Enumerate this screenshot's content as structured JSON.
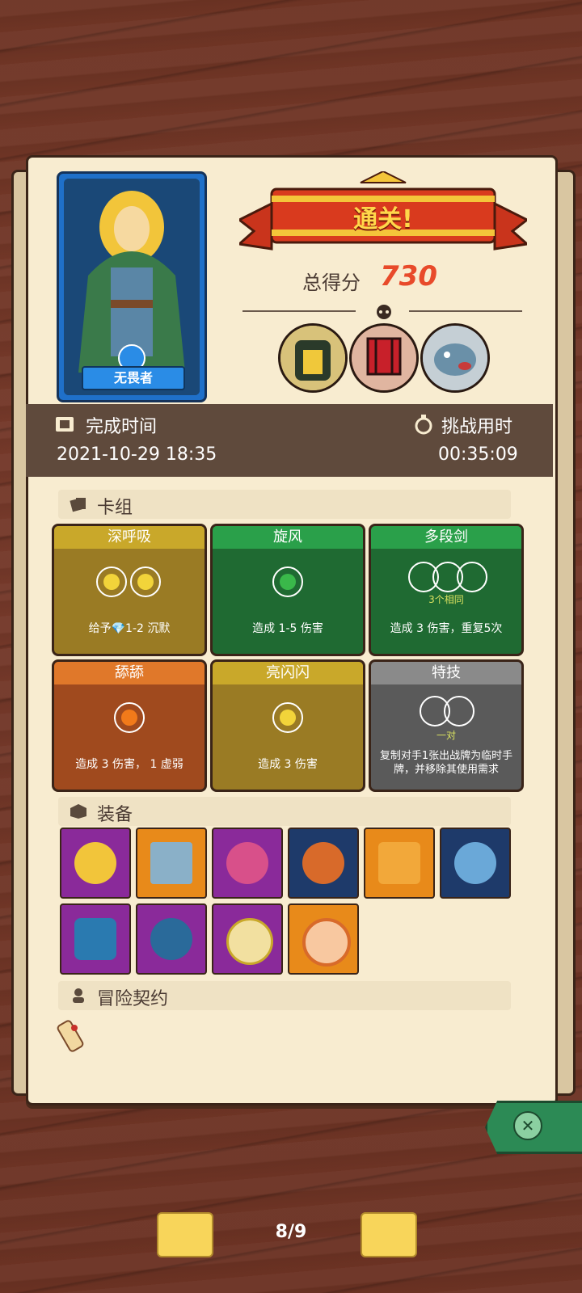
{
  "hero": {
    "name": "无畏者"
  },
  "result": {
    "banner": "通关!",
    "score_label": "总得分",
    "score": "730"
  },
  "info": {
    "finish_label": "完成时间",
    "finish_value": "2021-10-29 18:35",
    "time_label": "挑战用时",
    "time_value": "00:35:09"
  },
  "sections": {
    "deck": "卡组",
    "equipment": "装备",
    "contract": "冒险契约"
  },
  "cards": [
    {
      "name": "深呼吸",
      "desc": "给予💎1-2 沉默",
      "color": "#9a7b24",
      "sub": ""
    },
    {
      "name": "旋风",
      "desc": "造成 1-5 伤害",
      "color": "#1f6a32",
      "sub": ""
    },
    {
      "name": "多段剑",
      "desc": "造成 3 伤害，重复5次",
      "color": "#1f6a32",
      "sub": "3个相同"
    },
    {
      "name": "舔舔",
      "desc": "造成 3 伤害， 1 虚弱",
      "color": "#a04a1e",
      "sub": ""
    },
    {
      "name": "亮闪闪",
      "desc": "造成 3 伤害",
      "color": "#9a7b24",
      "sub": ""
    },
    {
      "name": "特技",
      "desc": "复制对手1张出战牌为临时手牌，并移除其使用需求",
      "color": "#5a5a5a",
      "sub": "一对"
    }
  ],
  "pager": {
    "label": "8/9"
  }
}
